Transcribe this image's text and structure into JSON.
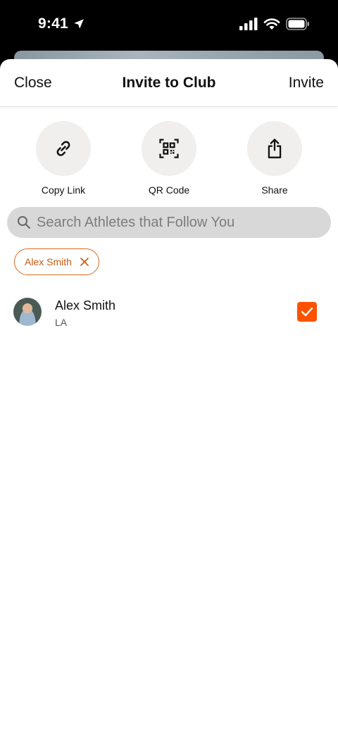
{
  "status_bar": {
    "time": "9:41"
  },
  "nav": {
    "close_label": "Close",
    "title": "Invite to Club",
    "invite_label": "Invite"
  },
  "actions": [
    {
      "label": "Copy Link",
      "icon": "link-icon"
    },
    {
      "label": "QR Code",
      "icon": "qr-code-icon"
    },
    {
      "label": "Share",
      "icon": "share-icon"
    }
  ],
  "search": {
    "placeholder": "Search Athletes that Follow You",
    "value": ""
  },
  "selected_chips": [
    {
      "label": "Alex Smith"
    }
  ],
  "athletes": [
    {
      "name": "Alex Smith",
      "location": "LA",
      "selected": true
    }
  ],
  "colors": {
    "accent": "#fc5200",
    "chip_border": "#d86a1f",
    "search_bg": "#d8d8d8",
    "action_bg": "#f0efee"
  }
}
